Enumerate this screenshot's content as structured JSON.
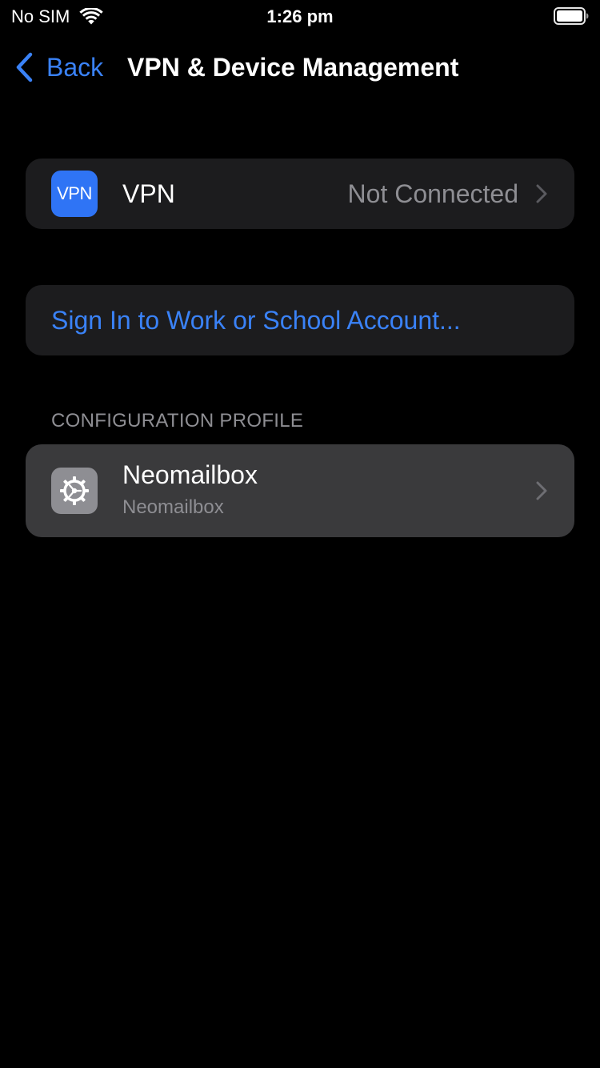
{
  "status_bar": {
    "carrier": "No SIM",
    "time": "1:26 pm"
  },
  "nav": {
    "back_label": "Back",
    "title": "VPN & Device Management"
  },
  "vpn_row": {
    "icon_text": "VPN",
    "label": "VPN",
    "status": "Not Connected"
  },
  "signin_row": {
    "label": "Sign In to Work or School Account..."
  },
  "configuration_section": {
    "header": "CONFIGURATION PROFILE",
    "profile": {
      "title": "Neomailbox",
      "subtitle": "Neomailbox",
      "icon": "gear-icon"
    }
  },
  "colors": {
    "background": "#000000",
    "group_background": "#1c1c1e",
    "selected_row": "#3a3a3c",
    "accent": "#3a82f7",
    "vpn_icon_bg": "#2f74f5",
    "secondary_text": "#8e8e93"
  }
}
